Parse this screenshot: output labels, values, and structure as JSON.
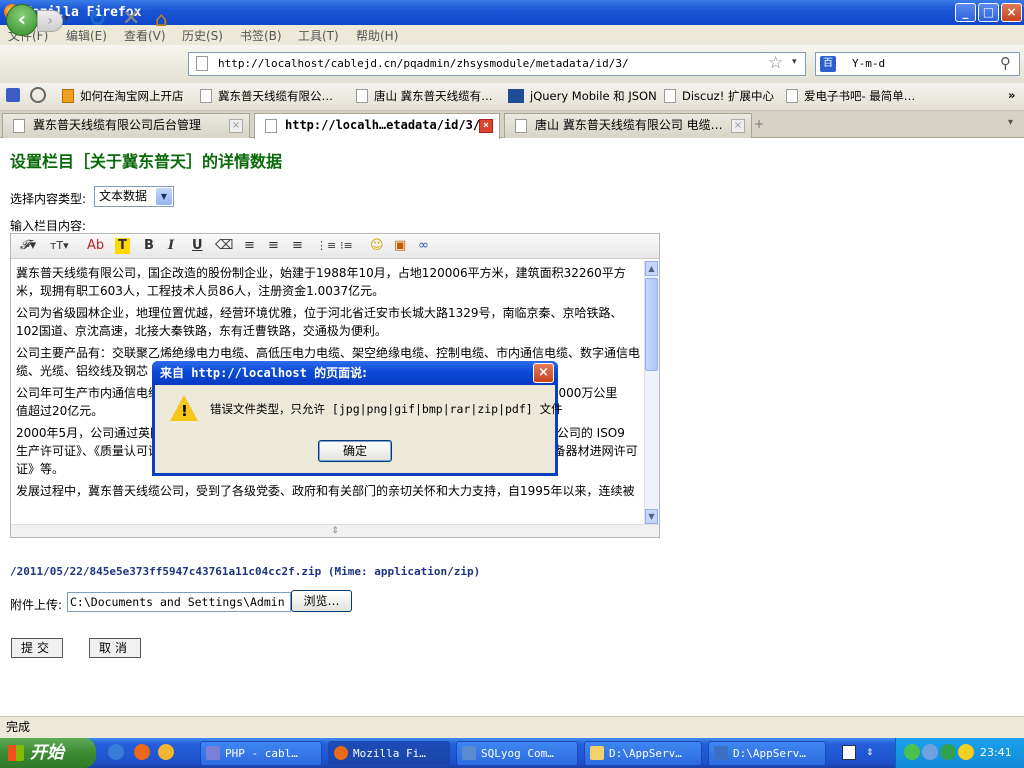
{
  "window": {
    "title": "Mozilla Firefox",
    "min": "_",
    "max": "□",
    "close": "×"
  },
  "menu": [
    "文件(F)",
    "编辑(E)",
    "查看(V)",
    "历史(S)",
    "书签(B)",
    "工具(T)",
    "帮助(H)"
  ],
  "nav": {
    "back": "‹",
    "forward": "›",
    "reload": "↻",
    "stop": "✕",
    "home": "⌂",
    "url": "http://localhost/cablejd.cn/pqadmin/zhsysmodule/metadata/id/3/",
    "star": "☆",
    "dropdown": "▾",
    "search_value": "Y-m-d",
    "search_engine": "百",
    "search_icon": "⚲"
  },
  "bookmarks": [
    "如何在淘宝网上开店",
    "冀东普天线缆有限公…",
    "唐山 冀东普天线缆有…",
    "jQuery Mobile 和 JSON",
    "Discuz! 扩展中心",
    "爱电子书吧- 最简单…"
  ],
  "bookmarks_more": "»",
  "tabs": [
    {
      "label": "冀东普天线缆有限公司后台管理",
      "active": false
    },
    {
      "label": "http://localh…etadata/id/3/",
      "active": true
    },
    {
      "label": "唐山 冀东普天线缆有限公司 电缆…",
      "active": false
    }
  ],
  "tab_close": "×",
  "new_tab": "+",
  "page": {
    "title": "设置栏目［关于冀东普天］的详情数据",
    "content_type_label": "选择内容类型:",
    "content_type_value": "文本数据",
    "content_label": "输入栏目内容:",
    "toolbar": [
      "𝓕▾",
      "тT▾",
      "Ab",
      "T",
      "B",
      "I",
      "U",
      "⌫",
      "≡",
      "≡",
      "≡",
      "⋮≡",
      "⁝≡",
      "☺",
      "▣",
      "∞"
    ],
    "editor_paragraphs": [
      "冀东普天线缆有限公司，国企改造的股份制企业，始建于1988年10月，占地120006平方米，建筑面积32260平方米，现拥有职工603人，工程技术人员86人，注册资金1.0037亿元。",
      "公司为省级园林企业，地理位置优越，经营环境优雅，位于河北省迁安市长城大路1329号，南临京秦、京哈铁路、102国道、京沈高速，北接大秦铁路，东有迁曹铁路，交通极为便利。",
      "公司主要产品有：交联聚乙烯绝缘电力电缆、高低压电力电缆、架空绝缘电缆、控制电缆、市内通信电缆、数字通信电缆、光缆、铝绞线及钢芯",
      "公司年可生产市内通信电缆                                                                   通信电缆20万箱、电线等1000万公里                                                                   值超过20亿元。",
      "2000年5月，公司通过英国                                                                  04年6月，通过了中国泰尔公司的 ISO9                                                                   生产许可证》、《质量认可证书》、                                                                   》和《国防通信网设备器材进网许可证》等。",
      "发展过程中，冀东普天线缆公司，受到了各级党委、政府和有关部门的亲切关怀和大力支持，自1995年以来，连续被"
    ],
    "file_path": "/2011/05/22/845e5e373ff5947c43761a11c04cc2f.zip  (Mime: application/zip)",
    "attach_label": "附件上传:",
    "attach_value": "C:\\Documents and Settings\\Admin",
    "browse": "浏览…",
    "submit": "提交",
    "cancel": "取消"
  },
  "dialog": {
    "title_prefix": "来自",
    "title_host": " http://localhost ",
    "title_suffix": "的页面说:",
    "message": "错误文件类型，只允许 [jpg|png|gif|bmp|rar|zip|pdf] 文件",
    "ok": "确定",
    "close": "×",
    "warn": "!"
  },
  "status": "完成",
  "taskbar": {
    "start": "开始",
    "tasks": [
      {
        "label": "PHP - cabl…",
        "active": false
      },
      {
        "label": "Mozilla Fi…",
        "active": true
      },
      {
        "label": "SQLyog Com…",
        "active": false
      },
      {
        "label": "D:\\AppServ…",
        "active": false
      },
      {
        "label": "D:\\AppServ…",
        "active": false
      }
    ],
    "clock": "23:41"
  }
}
